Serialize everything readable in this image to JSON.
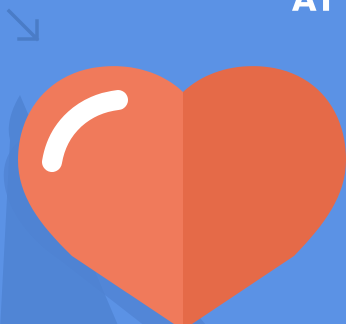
{
  "scene": {
    "background_color": "#5b92e5",
    "corner_text": "AT",
    "arrow_icon": "arrow-down-right-icon",
    "heart_icon": "heart-icon"
  },
  "colors": {
    "heart_left": "#f07a5b",
    "heart_right": "#e56a48",
    "shadow": "#4f82d2",
    "highlight": "#ffffff",
    "arrow": "#4a7cc7"
  }
}
